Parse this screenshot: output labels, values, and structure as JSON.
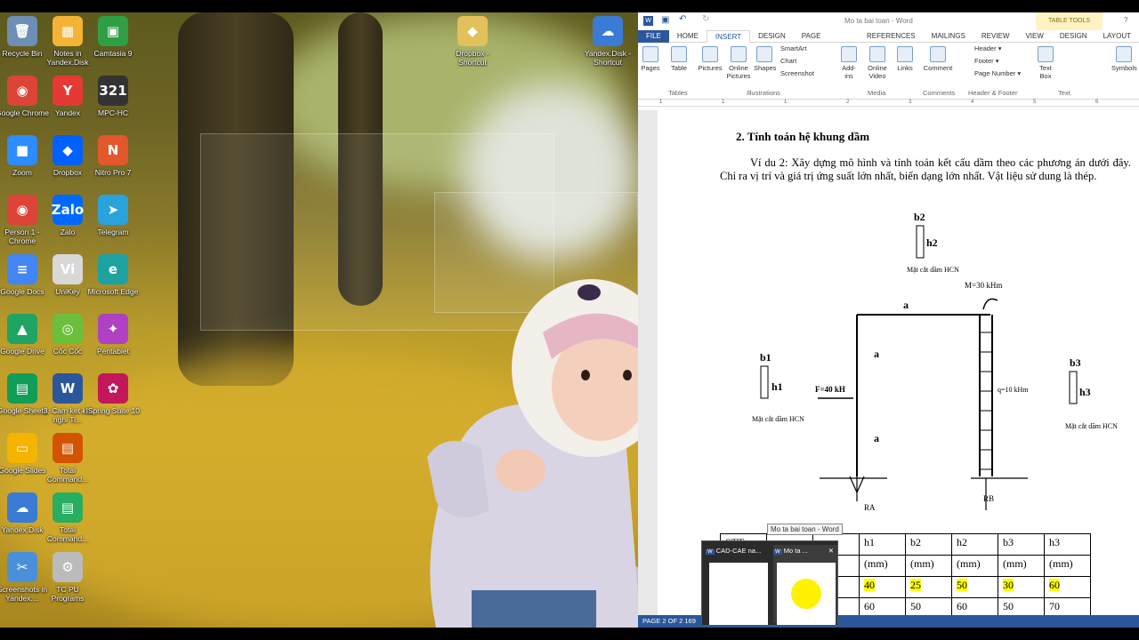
{
  "desktop": {
    "icons": [
      {
        "label": "Recycle Bin",
        "icon": "recycle-bin-icon",
        "color": "#6d8fb5",
        "glyph": "🗑",
        "col": 0,
        "row": 0
      },
      {
        "label": "Notes in Yandex.Disk",
        "icon": "notes-icon",
        "color": "#f5b335",
        "glyph": "▦",
        "col": 1,
        "row": 0
      },
      {
        "label": "Camtasia 9",
        "icon": "camtasia-icon",
        "color": "#2f9e44",
        "glyph": "▣",
        "col": 2,
        "row": 0
      },
      {
        "label": "Google Chrome",
        "icon": "chrome-icon",
        "color": "#db4437",
        "glyph": "◉",
        "col": 0,
        "row": 1
      },
      {
        "label": "Yandex",
        "icon": "yandex-icon",
        "color": "#e53935",
        "glyph": "Y",
        "col": 1,
        "row": 1
      },
      {
        "label": "MPC-HC",
        "icon": "mpc-hc-icon",
        "color": "#333333",
        "glyph": "321",
        "col": 2,
        "row": 1
      },
      {
        "label": "Zoom",
        "icon": "zoom-icon",
        "color": "#2d8cff",
        "glyph": "■",
        "col": 0,
        "row": 2
      },
      {
        "label": "Dropbox",
        "icon": "dropbox-icon",
        "color": "#0061fe",
        "glyph": "◆",
        "col": 1,
        "row": 2
      },
      {
        "label": "Nitro Pro 7",
        "icon": "nitro-icon",
        "color": "#e2572b",
        "glyph": "N",
        "col": 2,
        "row": 2
      },
      {
        "label": "Person 1 - Chrome",
        "icon": "chrome-icon",
        "color": "#db4437",
        "glyph": "◉",
        "col": 0,
        "row": 3
      },
      {
        "label": "Zalo",
        "icon": "zalo-icon",
        "color": "#0068ff",
        "glyph": "Zalo",
        "col": 1,
        "row": 3
      },
      {
        "label": "Telegram",
        "icon": "telegram-icon",
        "color": "#2aa3dd",
        "glyph": "➤",
        "col": 2,
        "row": 3
      },
      {
        "label": "Google Docs",
        "icon": "google-docs-icon",
        "color": "#4285f4",
        "glyph": "≡",
        "col": 0,
        "row": 4
      },
      {
        "label": "UniKey",
        "icon": "unikey-icon",
        "color": "#d8d8d8",
        "glyph": "Vi",
        "col": 1,
        "row": 4
      },
      {
        "label": "Microsoft Edge",
        "icon": "edge-icon",
        "color": "#1da1a1",
        "glyph": "e",
        "col": 2,
        "row": 4
      },
      {
        "label": "Google Drive",
        "icon": "google-drive-icon",
        "color": "#1fa463",
        "glyph": "▲",
        "col": 0,
        "row": 5
      },
      {
        "label": "Cốc Cốc",
        "icon": "coccoc-icon",
        "color": "#6cbf3b",
        "glyph": "◎",
        "col": 1,
        "row": 5
      },
      {
        "label": "Pentablet",
        "icon": "pentablet-icon",
        "color": "#b041c2",
        "glyph": "✦",
        "col": 2,
        "row": 5
      },
      {
        "label": "Google Sheets",
        "icon": "google-sheets-icon",
        "color": "#0f9d58",
        "glyph": "▤",
        "col": 0,
        "row": 6
      },
      {
        "label": "3. Cam ket khi nghi Ti...",
        "icon": "word-doc-icon",
        "color": "#2b579a",
        "glyph": "W",
        "col": 1,
        "row": 6
      },
      {
        "label": "iSpring Suite 10",
        "icon": "ispring-icon",
        "color": "#c2185b",
        "glyph": "✿",
        "col": 2,
        "row": 6
      },
      {
        "label": "Google Slides",
        "icon": "google-slides-icon",
        "color": "#f4b400",
        "glyph": "▭",
        "col": 0,
        "row": 7
      },
      {
        "label": "Total Command...",
        "icon": "total-commander-icon",
        "color": "#d35400",
        "glyph": "▤",
        "col": 1,
        "row": 7
      },
      {
        "label": "Yandex.Disk",
        "icon": "yandex-disk-icon",
        "color": "#3a7bd5",
        "glyph": "☁",
        "col": 0,
        "row": 8
      },
      {
        "label": "Total Command...",
        "icon": "total-commander-icon",
        "color": "#27ae60",
        "glyph": "▤",
        "col": 1,
        "row": 8
      },
      {
        "label": "Screenshots in Yandex....",
        "icon": "screenshot-icon",
        "color": "#4a90d9",
        "glyph": "✂",
        "col": 0,
        "row": 9
      },
      {
        "label": "TC PU Programs",
        "icon": "tc-pu-icon",
        "color": "#bbbbbb",
        "glyph": "⚙",
        "col": 1,
        "row": 9
      }
    ],
    "right_icons": [
      {
        "label": "Dropbox - Shortcut",
        "icon": "dropbox-shortcut-icon",
        "color": "#e2c15a",
        "glyph": "◆"
      },
      {
        "label": "Yandex.Disk - Shortcut",
        "icon": "yandex-disk-shortcut-icon",
        "color": "#3a7bd5",
        "glyph": "☁"
      }
    ]
  },
  "word": {
    "title": "Mo ta bai toan - Word",
    "context_tab": "TABLE TOOLS",
    "tabs": [
      "FILE",
      "HOME",
      "INSERT",
      "DESIGN",
      "PAGE LAYOUT",
      "REFERENCES",
      "MAILINGS",
      "REVIEW",
      "VIEW",
      "DESIGN",
      "LAYOUT"
    ],
    "ribbon": {
      "pages": "Pages",
      "table": "Table",
      "pictures": "Pictures",
      "online_pictures": "Online Pictures",
      "shapes": "Shapes",
      "smartart": "SmartArt",
      "chart": "Chart",
      "screenshot": "Screenshot",
      "addins": "Add-ins",
      "online_video": "Online Video",
      "links": "Links",
      "comment": "Comment",
      "header": "Header",
      "footer": "Footer",
      "page_number": "Page Number",
      "text_box": "Text Box",
      "symbols": "Symbols",
      "groups": {
        "tables": "Tables",
        "illustrations": "Illustrations",
        "media": "Media",
        "comments": "Comments",
        "header_footer": "Header & Footer",
        "text": "Text"
      }
    },
    "ruler": [
      "1",
      "1",
      "1",
      "2",
      "3",
      "4",
      "5",
      "6"
    ],
    "doc": {
      "heading": "2.  Tính toán hệ khung dầm",
      "paragraph": "Ví du 2: Xây dựng mô hình và tính toán kết cấu dầm theo các phương án dưới đây. Chỉ ra vị trí và giá trị ứng suất lớn nhất, biến dạng lớn nhất. Vật liệu sử dung là thép.",
      "diagram": {
        "b2": "b2",
        "h2": "h2",
        "cut_top": "Mặt cắt dầm HCN",
        "moment": "M=30 kHm",
        "a_top": "a",
        "a_left1": "a",
        "a_left2": "a",
        "force": "F=40 kH",
        "load": "q=10 kHm",
        "b1": "b1",
        "h1": "h1",
        "cut_left": "Mặt cắt dầm HCN",
        "b3": "b3",
        "h3": "h3",
        "cut_right": "Mặt cắt dầm HCN",
        "ra": "RA",
        "rb": "RB"
      },
      "table": {
        "header1": [
          "STT",
          "a",
          "",
          "h1",
          "b2",
          "h2",
          "b3",
          "h3"
        ],
        "header2": [
          "",
          "",
          "",
          "(mm)",
          "(mm)",
          "(mm)",
          "(mm)",
          "(mm)"
        ],
        "row1": [
          "",
          "",
          "",
          "40",
          "25",
          "50",
          "30",
          "60"
        ],
        "row2": [
          "",
          "",
          "",
          "60",
          "50",
          "60",
          "50",
          "70"
        ]
      }
    },
    "status": "PAGE 2 OF 2    169"
  },
  "taskbar_preview": {
    "tooltip": "Mo ta bai toan - Word",
    "items": [
      "CAD-CAE na...",
      "Mo ta ..."
    ]
  }
}
